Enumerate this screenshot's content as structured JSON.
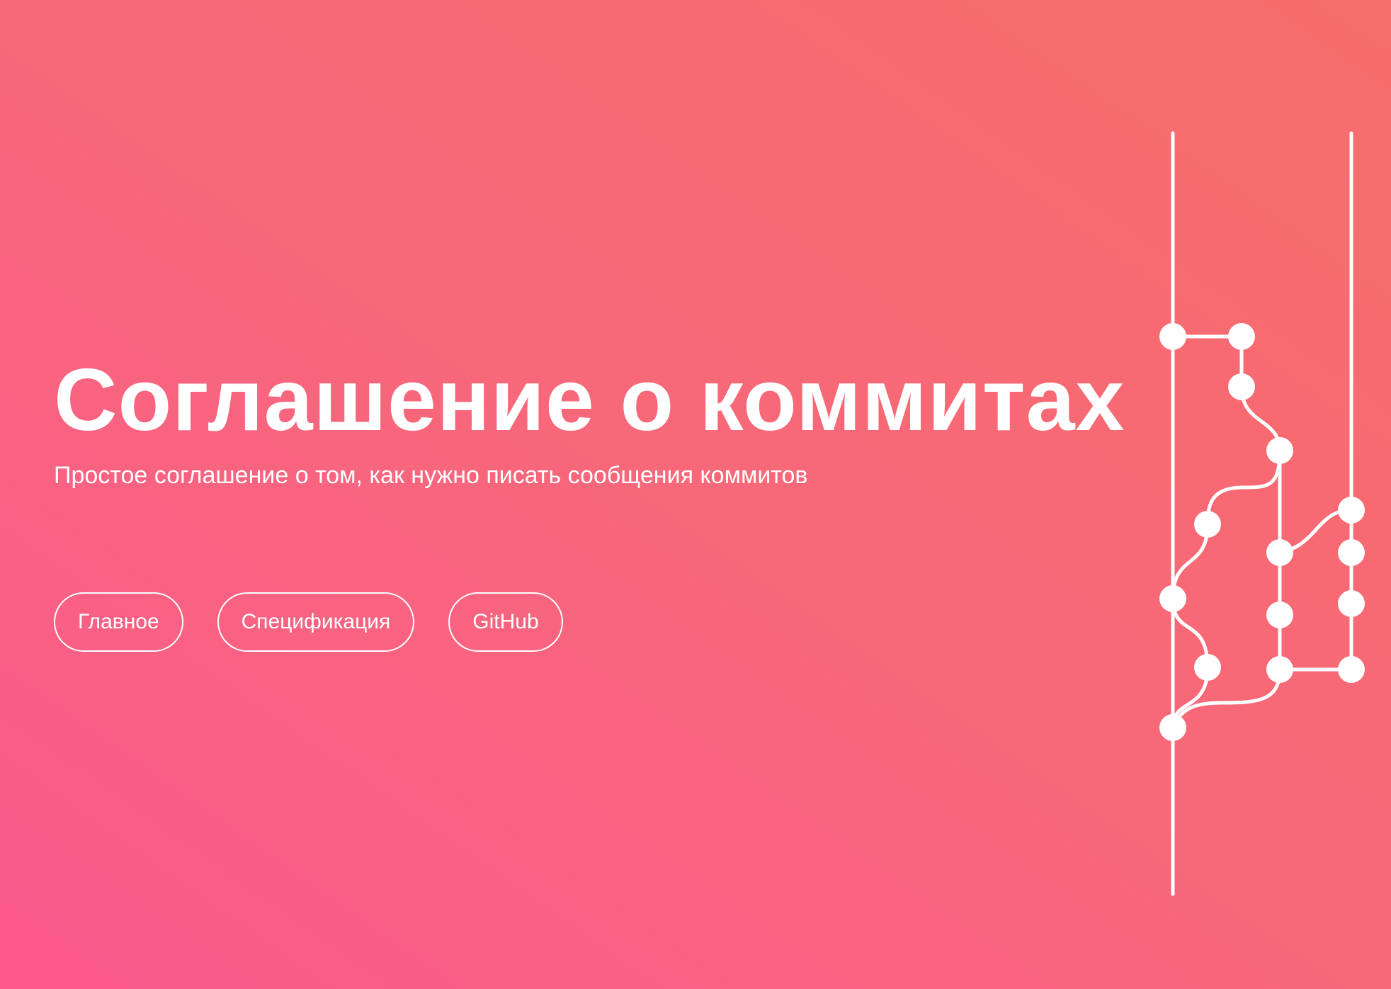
{
  "hero": {
    "title": "Соглашение о коммитах",
    "subtitle": "Простое соглашение о том, как нужно писать сообщения коммитов"
  },
  "nav": {
    "main_label": "Главное",
    "spec_label": "Спецификация",
    "github_label": "GitHub"
  },
  "colors": {
    "gradient_start": "#fc5a8d",
    "gradient_end": "#f76d6a",
    "foreground": "#ffffff"
  }
}
